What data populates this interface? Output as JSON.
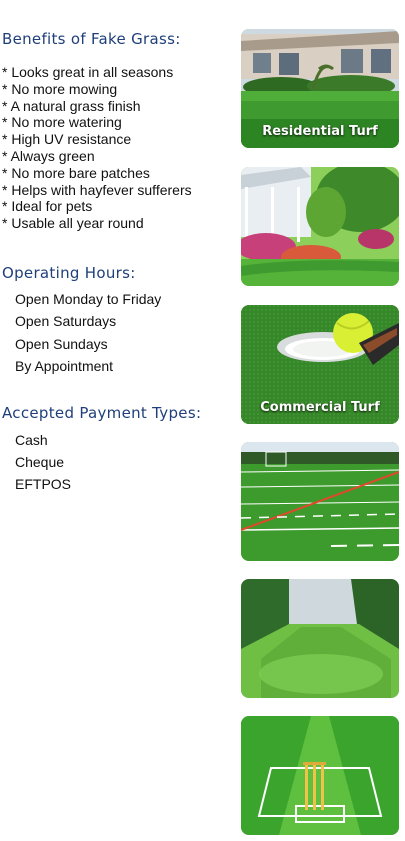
{
  "benefits": {
    "heading": "Benefits of Fake Grass:",
    "items": [
      "* Looks great in all seasons",
      "* No more mowing",
      "* A natural grass finish",
      "* No more watering",
      "* High UV resistance",
      "* Always green",
      "* No more bare patches",
      "* Helps with hayfever sufferers",
      "* Ideal for pets",
      "* Usable all year round"
    ]
  },
  "hours": {
    "heading": "Operating Hours:",
    "items": [
      "Open Monday to Friday",
      "Open Saturdays",
      "Open Sundays",
      "By Appointment"
    ]
  },
  "payment": {
    "heading": "Accepted Payment Types:",
    "items": [
      "Cash",
      "Cheque",
      "EFTPOS"
    ]
  },
  "gallery": {
    "residential_caption": "Residential Turf",
    "commercial_caption": "Commercial Turf"
  },
  "colors": {
    "heading": "#1f3f7a",
    "turf_green": "#3f9a2f",
    "tile_border": "#b9c79c"
  }
}
